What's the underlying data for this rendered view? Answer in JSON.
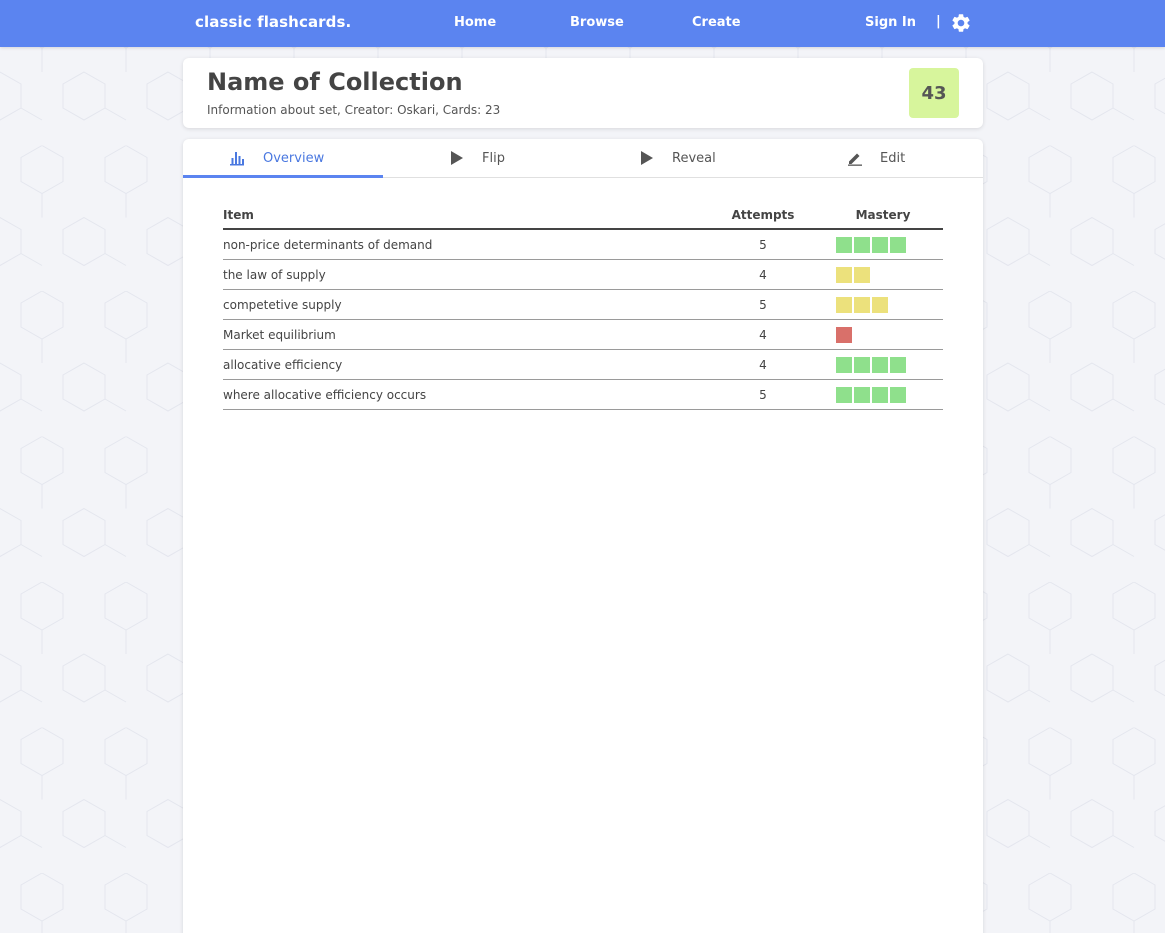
{
  "nav": {
    "brand": "classic flashcards.",
    "home": "Home",
    "browse": "Browse",
    "create": "Create",
    "sign_in": "Sign In",
    "separator": "|",
    "settings_icon": "gear-icon"
  },
  "collection": {
    "title": "Name of Collection",
    "info": "Information about set, Creator: Oskari, Cards: 23",
    "score": "43"
  },
  "tabs": [
    {
      "label": "Overview",
      "icon": "bar-chart-icon",
      "active": true
    },
    {
      "label": "Flip",
      "icon": "play-icon",
      "active": false
    },
    {
      "label": "Reveal",
      "icon": "play-icon",
      "active": false
    },
    {
      "label": "Edit",
      "icon": "pencil-icon",
      "active": false
    }
  ],
  "table": {
    "headers": {
      "item": "Item",
      "attempts": "Attempts",
      "mastery": "Mastery"
    },
    "rows": [
      {
        "item": "non-price determinants of demand",
        "attempts": "5",
        "mastery": 4,
        "mastery_color": "green"
      },
      {
        "item": "the law of supply",
        "attempts": "4",
        "mastery": 2,
        "mastery_color": "yellow"
      },
      {
        "item": "competetive supply",
        "attempts": "5",
        "mastery": 3,
        "mastery_color": "yellow"
      },
      {
        "item": "Market equilibrium",
        "attempts": "4",
        "mastery": 1,
        "mastery_color": "red"
      },
      {
        "item": "allocative efficiency",
        "attempts": "4",
        "mastery": 4,
        "mastery_color": "green"
      },
      {
        "item": "where allocative efficiency occurs",
        "attempts": "5",
        "mastery": 4,
        "mastery_color": "green"
      }
    ]
  },
  "colors": {
    "navbar": "#5b84f0",
    "accent": "#4a78e0",
    "score_badge": "#d7f59c",
    "mastery_green": "#8fe08c",
    "mastery_yellow": "#ece17c",
    "mastery_red": "#d9706a"
  }
}
